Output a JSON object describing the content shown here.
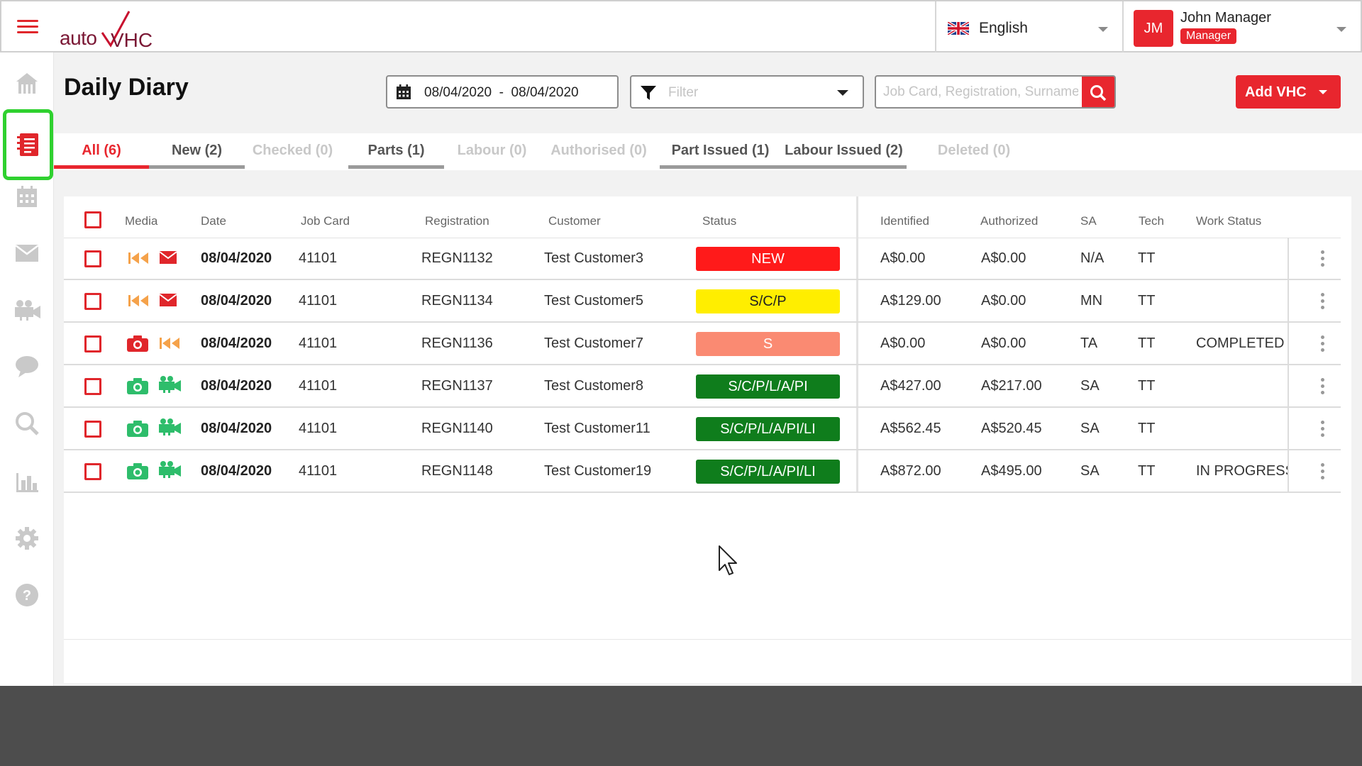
{
  "header": {
    "logo_text": "autoVHC",
    "language": "English",
    "user": {
      "initials": "JM",
      "name": "John Manager",
      "role": "Manager"
    }
  },
  "sidebar": {
    "items": [
      {
        "icon": "home-icon"
      },
      {
        "icon": "diary-icon",
        "active": true
      },
      {
        "icon": "calendar-icon"
      },
      {
        "icon": "mail-icon"
      },
      {
        "icon": "video-camera-icon"
      },
      {
        "icon": "chat-icon"
      },
      {
        "icon": "search-icon"
      },
      {
        "icon": "bar-chart-icon"
      },
      {
        "icon": "gear-icon"
      },
      {
        "icon": "help-icon"
      }
    ]
  },
  "page": {
    "title": "Daily Diary",
    "date_range": "08/04/2020  -  08/04/2020",
    "filter_placeholder": "Filter",
    "search_placeholder": "Job Card, Registration, Surname",
    "add_button": "Add VHC"
  },
  "tabs": [
    {
      "label": "All (6)"
    },
    {
      "label": "New (2)"
    },
    {
      "label": "Checked (0)"
    },
    {
      "label": "Parts (1)"
    },
    {
      "label": "Labour (0)"
    },
    {
      "label": "Authorised (0)"
    },
    {
      "label": "Part Issued (1)"
    },
    {
      "label": "Labour Issued (2)"
    },
    {
      "label": "Deleted (0)"
    }
  ],
  "table": {
    "columns": [
      "Media",
      "Date",
      "Job Card",
      "Registration",
      "Customer",
      "Status",
      "Identified",
      "Authorized",
      "SA",
      "Tech",
      "Work Status"
    ],
    "rows": [
      {
        "date": "08/04/2020",
        "job": "41101",
        "reg": "REGN1132",
        "customer": "Test Customer3",
        "status": "NEW",
        "identified": "A$0.00",
        "authorized": "A$0.00",
        "sa": "N/A",
        "tech": "TT",
        "work": ""
      },
      {
        "date": "08/04/2020",
        "job": "41101",
        "reg": "REGN1134",
        "customer": "Test Customer5",
        "status": "S/C/P",
        "identified": "A$129.00",
        "authorized": "A$0.00",
        "sa": "MN",
        "tech": "TT",
        "work": ""
      },
      {
        "date": "08/04/2020",
        "job": "41101",
        "reg": "REGN1136",
        "customer": "Test Customer7",
        "status": "S",
        "identified": "A$0.00",
        "authorized": "A$0.00",
        "sa": "TA",
        "tech": "TT",
        "work": "COMPLETED"
      },
      {
        "date": "08/04/2020",
        "job": "41101",
        "reg": "REGN1137",
        "customer": "Test Customer8",
        "status": "S/C/P/L/A/PI",
        "identified": "A$427.00",
        "authorized": "A$217.00",
        "sa": "SA",
        "tech": "TT",
        "work": ""
      },
      {
        "date": "08/04/2020",
        "job": "41101",
        "reg": "REGN1140",
        "customer": "Test Customer11",
        "status": "S/C/P/L/A/PI/LI",
        "identified": "A$562.45",
        "authorized": "A$520.45",
        "sa": "SA",
        "tech": "TT",
        "work": ""
      },
      {
        "date": "08/04/2020",
        "job": "41101",
        "reg": "REGN1148",
        "customer": "Test Customer19",
        "status": "S/C/P/L/A/PI/LI",
        "identified": "A$872.00",
        "authorized": "A$495.00",
        "sa": "SA",
        "tech": "TT",
        "work": "IN PROGRESS"
      }
    ]
  },
  "colors": {
    "accent": "#e8262e",
    "status_new": "#ff1a1a",
    "status_scp": "#ffee00",
    "status_s": "#fa8a72",
    "status_done": "#0f7d1c",
    "media_green": "#2ebd6b",
    "sidebar_highlight": "#2fd12f"
  }
}
